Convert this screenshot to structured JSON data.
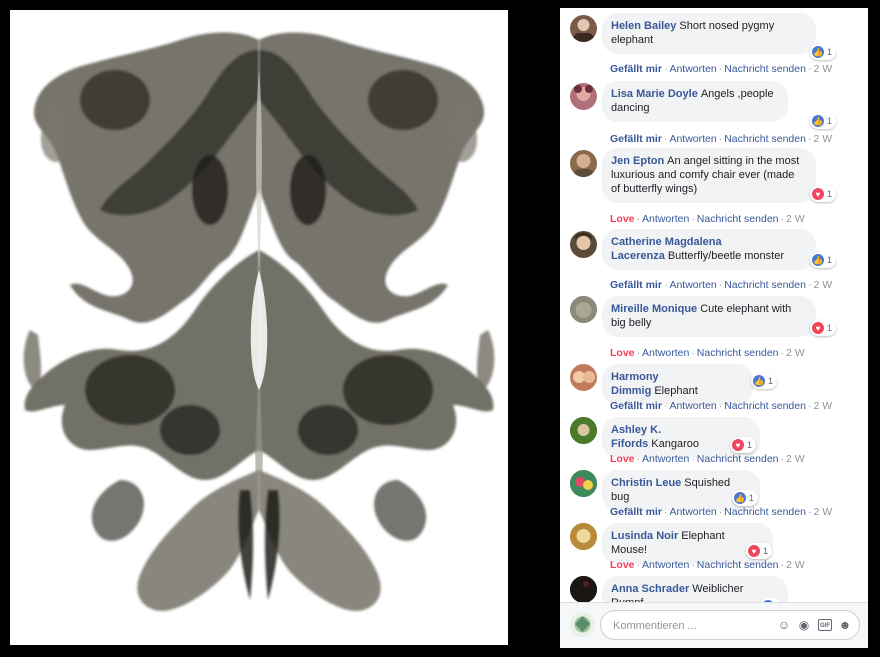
{
  "composer": {
    "placeholder": "Kommentieren ...",
    "tools": [
      "emoji-icon",
      "camera-icon",
      "gif-icon",
      "sticker-icon"
    ]
  },
  "comments": [
    {
      "author": "Helen Bailey",
      "text": "Short nosed pygmy elephant",
      "reaction": "like",
      "count": "1",
      "actions": [
        "Gefällt mir",
        "Antworten",
        "Nachricht senden"
      ],
      "time": "2 W",
      "liked": "like"
    },
    {
      "author": "Lisa Marie Doyle",
      "text": "Angels ,people dancing",
      "reaction": "like",
      "count": "1",
      "actions": [
        "Gefällt mir",
        "Antworten",
        "Nachricht senden"
      ],
      "time": "2 W",
      "liked": "like"
    },
    {
      "author": "Jen Epton",
      "text": "An angel sitting in the most luxurious and comfy chair ever (made of butterfly wings)",
      "reaction": "love",
      "count": "1",
      "actions": [
        "Love",
        "Antworten",
        "Nachricht senden"
      ],
      "time": "2 W",
      "liked": "love"
    },
    {
      "author": "Catherine Magdalena Lacerenza",
      "text": "Butterfly/beetle monster",
      "reaction": "like",
      "count": "1",
      "actions": [
        "Gefällt mir",
        "Antworten",
        "Nachricht senden"
      ],
      "time": "2 W",
      "liked": "like"
    },
    {
      "author": "Mireille Monique",
      "text": "Cute elephant with big belly",
      "reaction": "love",
      "count": "1",
      "actions": [
        "Love",
        "Antworten",
        "Nachricht senden"
      ],
      "time": "2 W",
      "liked": "love"
    },
    {
      "author": "Harmony Dimmig",
      "text": "Elephant",
      "reaction": "like",
      "count": "1",
      "actions": [
        "Gefällt mir",
        "Antworten",
        "Nachricht senden"
      ],
      "time": "2 W",
      "liked": "like"
    },
    {
      "author": "Ashley K. Fifords",
      "text": "Kangaroo",
      "reaction": "love",
      "count": "1",
      "actions": [
        "Love",
        "Antworten",
        "Nachricht senden"
      ],
      "time": "2 W",
      "liked": "love"
    },
    {
      "author": "Christin Leue",
      "text": "Squished bug",
      "reaction": "like",
      "count": "1",
      "actions": [
        "Gefällt mir",
        "Antworten",
        "Nachricht senden"
      ],
      "time": "2 W",
      "liked": "like"
    },
    {
      "author": "Lusinda Noir",
      "text": "Elephant Mouse!",
      "reaction": "love",
      "count": "1",
      "actions": [
        "Love",
        "Antworten",
        "Nachricht senden"
      ],
      "time": "2 W",
      "liked": "love"
    },
    {
      "author": "Anna Schrader",
      "text": "Weiblicher Rumpf",
      "reaction": "like",
      "count": "",
      "actions": [],
      "time": "",
      "liked": "like"
    }
  ],
  "colors": {
    "link": "#385898",
    "love": "#f33e58",
    "like": "#4a76d6",
    "bubble": "#f2f3f5"
  }
}
